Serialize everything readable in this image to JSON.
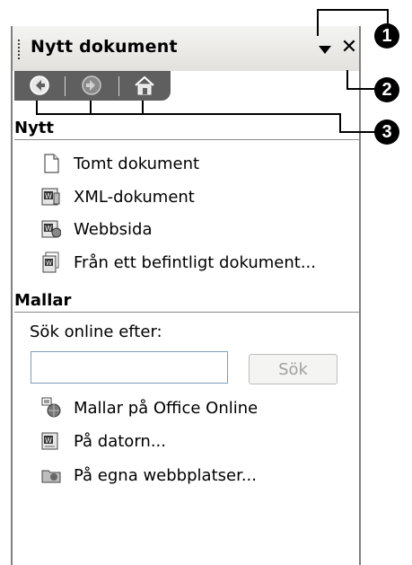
{
  "task_pane": {
    "title": "Nytt dokument",
    "menu_arrow_icon": "dropdown-triangle-icon",
    "close_label": "✕"
  },
  "nav": {
    "back_icon": "back-arrow-icon",
    "forward_icon": "forward-arrow-icon",
    "home_icon": "home-icon"
  },
  "sections": {
    "new": {
      "heading": "Nytt",
      "items": [
        {
          "label": "Tomt dokument",
          "icon": "blank-document-icon"
        },
        {
          "label": "XML-dokument",
          "icon": "xml-word-document-icon"
        },
        {
          "label": "Webbsida",
          "icon": "web-page-document-icon"
        },
        {
          "label": "Från ett befintligt dokument...",
          "icon": "existing-document-icon"
        }
      ]
    },
    "templates": {
      "heading": "Mallar",
      "search_label": "Sök online efter:",
      "search_value": "",
      "search_button": "Sök",
      "items": [
        {
          "label": "Mallar på Office Online",
          "icon": "office-online-templates-icon"
        },
        {
          "label": "På datorn...",
          "icon": "computer-templates-icon"
        },
        {
          "label": "På egna webbplatser...",
          "icon": "web-folder-icon"
        }
      ]
    }
  },
  "callouts": [
    "1",
    "2",
    "3"
  ]
}
